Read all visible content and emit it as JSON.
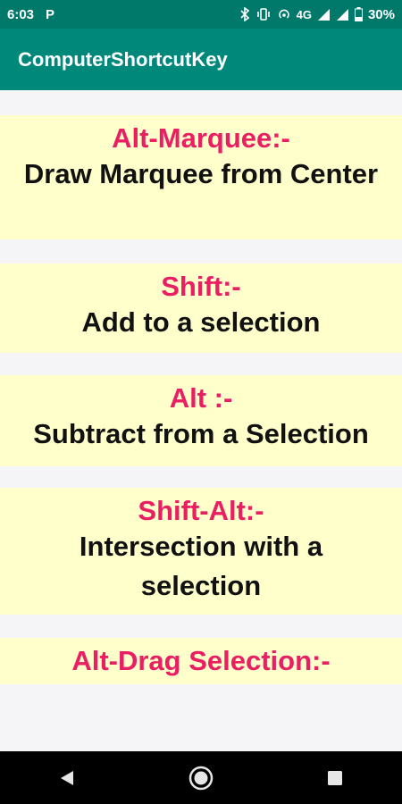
{
  "status_bar": {
    "time": "6:03",
    "left_icon": "parking-p-icon",
    "network": "4G",
    "battery": "30%"
  },
  "app_bar": {
    "title": "ComputerShortcutKey"
  },
  "shortcuts": [
    {
      "key": "Alt-Marquee:-",
      "desc": "Draw Marquee from Center"
    },
    {
      "key": "Shift:-",
      "desc": "Add to a selection"
    },
    {
      "key": "Alt :-",
      "desc": "Subtract from a Selection"
    },
    {
      "key": "Shift-Alt:-",
      "desc": "Intersection with a selection"
    },
    {
      "key": "Alt-Drag Selection:-",
      "desc": ""
    }
  ],
  "colors": {
    "status_bar": "#00796b",
    "app_bar": "#00897b",
    "card_bg": "#ffffcc",
    "key_text": "#e91e63",
    "desc_text": "#111111"
  },
  "nav_bar": {
    "icons": [
      "back-icon",
      "home-icon",
      "recents-icon"
    ]
  }
}
